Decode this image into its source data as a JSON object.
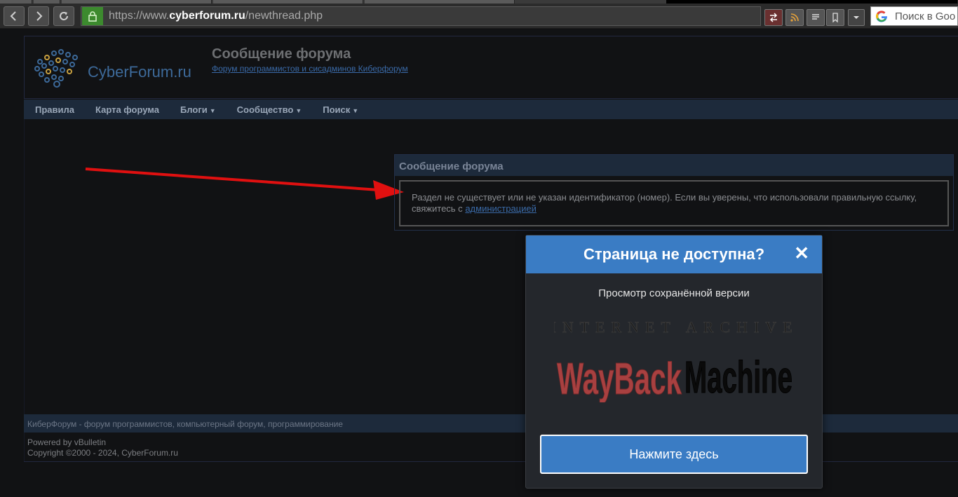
{
  "browser": {
    "url_prefix": "https://www.",
    "url_domain": "cyberforum.ru",
    "url_path": "/newthread.php",
    "search_placeholder": "Поиск в Goo"
  },
  "header": {
    "logo_text": "CyberForum.ru",
    "title": "Сообщение форума",
    "subtitle_link": "Форум программистов и сисадминов Киберфорум"
  },
  "nav": {
    "items": [
      {
        "label": "Правила",
        "dropdown": false
      },
      {
        "label": "Карта форума",
        "dropdown": false
      },
      {
        "label": "Блоги",
        "dropdown": true
      },
      {
        "label": "Сообщество",
        "dropdown": true
      },
      {
        "label": "Поиск",
        "dropdown": true
      }
    ]
  },
  "message": {
    "header": "Сообщение форума",
    "text": "Раздел не существует или не указан идентификатор (номер). Если вы уверены, что использовали правильную ссылку, свяжитесь с",
    "link": "администрацией"
  },
  "footer": {
    "bar_text": "КиберФорум - форум программистов, компьютерный форум, программирование",
    "powered": "Powered by vBulletin",
    "copyright": "Copyright ©2000 - 2024, CyberForum.ru"
  },
  "popup": {
    "title": "Страница не доступна?",
    "close": "✕",
    "subtitle": "Просмотр сохранённой версии",
    "logo_top": "INTERNET ARCHIVE",
    "logo_word1": "WayBack",
    "logo_word2": "Machine",
    "button": "Нажмите здесь"
  },
  "colors": {
    "accent": "#3a7cc4",
    "arrow": "#e01010",
    "nav_bg": "#1d2a3b"
  }
}
